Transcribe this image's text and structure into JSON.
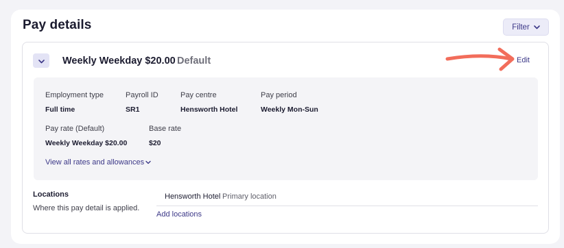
{
  "header": {
    "title": "Pay details",
    "filter_label": "Filter",
    "filter_icon": "chevron-down-icon"
  },
  "card": {
    "toggle_icon": "chevron-down-icon",
    "title": "Weekly Weekday $20.00",
    "tag": "Default",
    "edit_label": "Edit",
    "annotation": "red-arrow-pointing-right",
    "annotation_color": "#f26d5b"
  },
  "details": {
    "employment_type": {
      "label": "Employment type",
      "value": "Full time"
    },
    "payroll_id": {
      "label": "Payroll ID",
      "value": "SR1"
    },
    "pay_centre": {
      "label": "Pay centre",
      "value": "Hensworth Hotel"
    },
    "pay_period": {
      "label": "Pay period",
      "value": "Weekly Mon-Sun"
    },
    "pay_rate": {
      "label": "Pay rate (Default)",
      "value": "Weekly Weekday $20.00"
    },
    "base_rate": {
      "label": "Base rate",
      "value": "$20"
    },
    "rates_link": "View all rates and allowances"
  },
  "locations": {
    "label": "Locations",
    "description": "Where this pay detail is applied.",
    "items": [
      {
        "name": "Hensworth Hotel",
        "note": "Primary location"
      }
    ],
    "add_label": "Add locations"
  },
  "colors": {
    "accent": "#3b3787",
    "background": "#f3f3f7",
    "details_bg": "#f4f4f7"
  }
}
